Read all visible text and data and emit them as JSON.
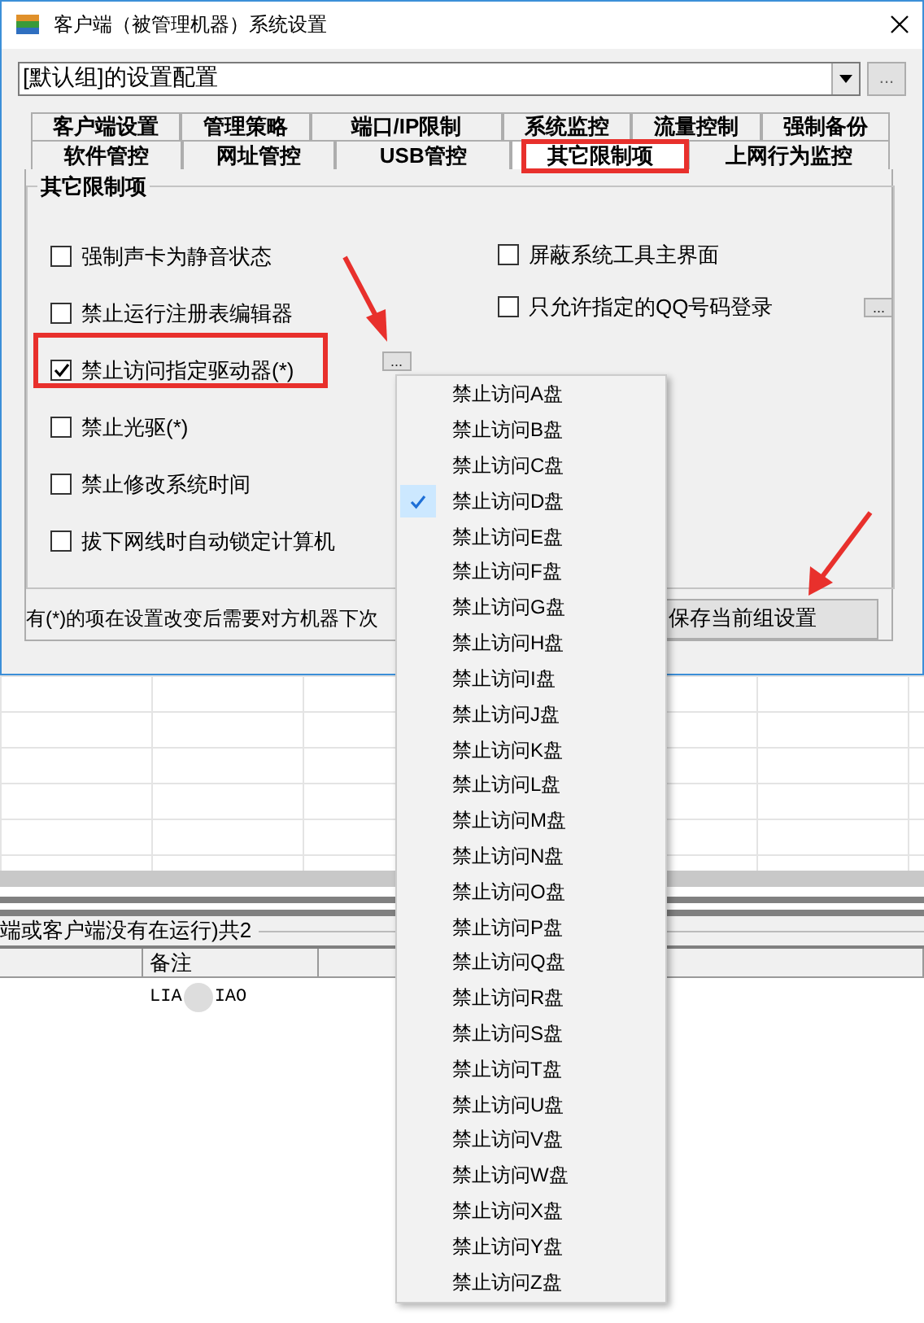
{
  "window": {
    "title": "客户端（被管理机器）系统设置"
  },
  "config": {
    "value": "[默认组]的设置配置",
    "more_button": "..."
  },
  "tab_rows": [
    {
      "tabs": [
        {
          "label": "客户端设置",
          "selected": false
        },
        {
          "label": "管理策略",
          "selected": false
        },
        {
          "label": "端口/IP限制",
          "selected": false
        },
        {
          "label": "系统监控",
          "selected": false
        },
        {
          "label": "流量控制",
          "selected": false
        },
        {
          "label": "强制备份",
          "selected": false
        }
      ]
    },
    {
      "tabs": [
        {
          "label": "软件管控",
          "selected": false
        },
        {
          "label": "网址管控",
          "selected": false
        },
        {
          "label": "USB管控",
          "selected": false
        },
        {
          "label": "其它限制项",
          "selected": true
        },
        {
          "label": "上网行为监控",
          "selected": false
        }
      ]
    }
  ],
  "group": {
    "title": "其它限制项",
    "left_options": [
      {
        "label": "强制声卡为静音状态",
        "checked": false
      },
      {
        "label": "禁止运行注册表编辑器",
        "checked": false
      },
      {
        "label": "禁止访问指定驱动器(*)",
        "checked": true,
        "button": "..."
      },
      {
        "label": "禁止光驱(*)",
        "checked": false
      },
      {
        "label": "禁止修改系统时间",
        "checked": false
      },
      {
        "label": "拔下网线时自动锁定计算机",
        "checked": false
      }
    ],
    "right_options": [
      {
        "label": "屏蔽系统工具主界面",
        "checked": false
      },
      {
        "label": "只允许指定的QQ号码登录",
        "checked": false,
        "button": "..."
      }
    ]
  },
  "note": "有(*)的项在设置改变后需要对方机器下次",
  "save_button": "保存当前组设置",
  "drive_menu": [
    {
      "label": "禁止访问A盘",
      "checked": false
    },
    {
      "label": "禁止访问B盘",
      "checked": false
    },
    {
      "label": "禁止访问C盘",
      "checked": false
    },
    {
      "label": "禁止访问D盘",
      "checked": true
    },
    {
      "label": "禁止访问E盘",
      "checked": false
    },
    {
      "label": "禁止访问F盘",
      "checked": false
    },
    {
      "label": "禁止访问G盘",
      "checked": false
    },
    {
      "label": "禁止访问H盘",
      "checked": false
    },
    {
      "label": "禁止访问I盘",
      "checked": false
    },
    {
      "label": "禁止访问J盘",
      "checked": false
    },
    {
      "label": "禁止访问K盘",
      "checked": false
    },
    {
      "label": "禁止访问L盘",
      "checked": false
    },
    {
      "label": "禁止访问M盘",
      "checked": false
    },
    {
      "label": "禁止访问N盘",
      "checked": false
    },
    {
      "label": "禁止访问O盘",
      "checked": false
    },
    {
      "label": "禁止访问P盘",
      "checked": false
    },
    {
      "label": "禁止访问Q盘",
      "checked": false
    },
    {
      "label": "禁止访问R盘",
      "checked": false
    },
    {
      "label": "禁止访问S盘",
      "checked": false
    },
    {
      "label": "禁止访问T盘",
      "checked": false
    },
    {
      "label": "禁止访问U盘",
      "checked": false
    },
    {
      "label": "禁止访问V盘",
      "checked": false
    },
    {
      "label": "禁止访问W盘",
      "checked": false
    },
    {
      "label": "禁止访问X盘",
      "checked": false
    },
    {
      "label": "禁止访问Y盘",
      "checked": false
    },
    {
      "label": "禁止访问Z盘",
      "checked": false
    }
  ],
  "background_list": {
    "status": "端或客户端没有在运行)共2",
    "column_2": "备注",
    "cell_start": "LIA",
    "cell_end": "IAO"
  }
}
